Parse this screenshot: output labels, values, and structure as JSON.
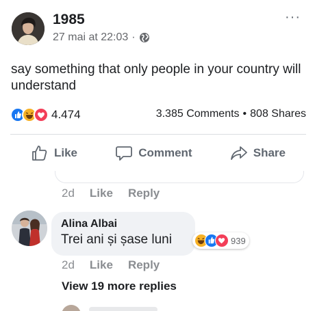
{
  "post": {
    "author": "1985",
    "date": "27 mai at 22:03",
    "separator": "·",
    "more": "···",
    "text": "say something that only people in your country will understand"
  },
  "stats": {
    "reaction_icons": [
      "like-icon",
      "haha-icon",
      "love-icon"
    ],
    "reactions_count": "4.474",
    "comments": "3.385 Comments",
    "dot": "•",
    "shares": "808 Shares"
  },
  "actions": {
    "like": "Like",
    "comment": "Comment",
    "share": "Share"
  },
  "prev_comment": {
    "time": "2d",
    "like": "Like",
    "reply": "Reply"
  },
  "comment": {
    "name": "Alina Albai",
    "text": "Trei ani și șase luni",
    "reaction_icons": [
      "haha-icon",
      "like-icon",
      "love-icon"
    ],
    "reactions_count": "939",
    "time": "2d",
    "like": "Like",
    "reply": "Reply"
  },
  "view_replies": "View 19 more replies",
  "colors": {
    "like_blue": "#1877f2",
    "love_red": "#f33e58",
    "haha_yellow": "#f7b125",
    "text": "#1c1e21",
    "muted": "#65676b"
  }
}
